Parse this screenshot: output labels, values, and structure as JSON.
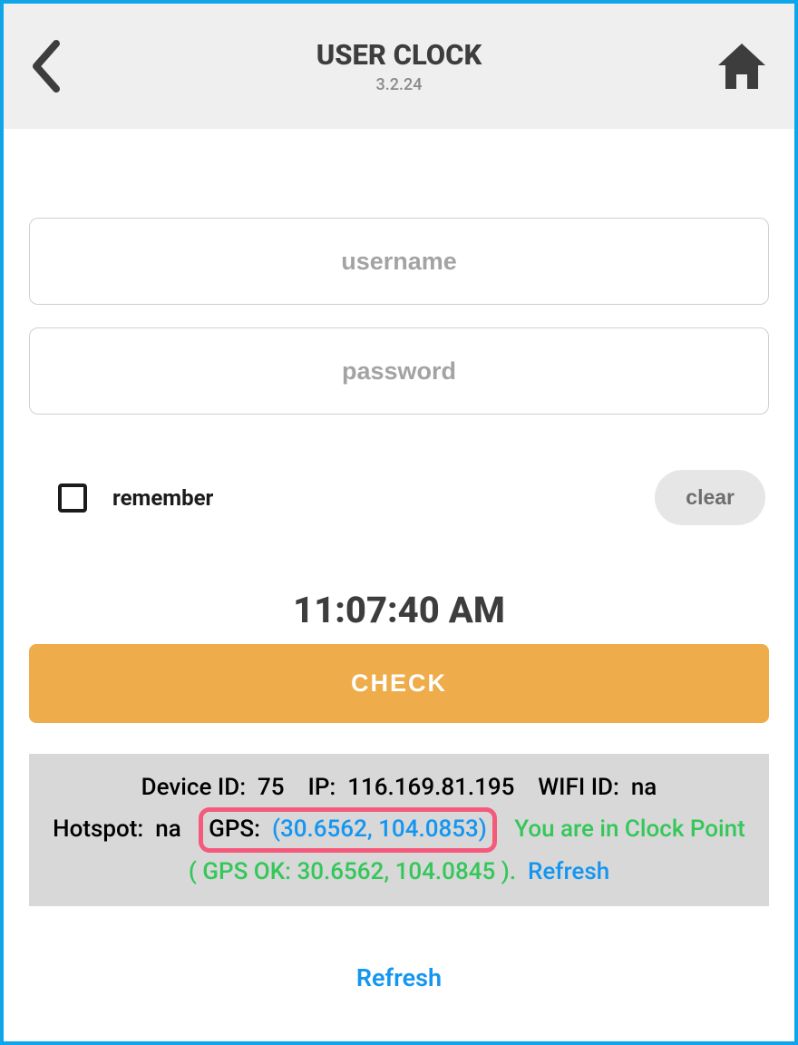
{
  "header": {
    "title": "USER CLOCK",
    "version": "3.2.24"
  },
  "form": {
    "username_placeholder": "username",
    "password_placeholder": "password",
    "remember_label": "remember",
    "clear_label": "clear"
  },
  "time": "11:07:40 AM",
  "check_label": "CHECK",
  "status": {
    "device_id_label": "Device ID:",
    "device_id": "75",
    "ip_label": "IP:",
    "ip": "116.169.81.195",
    "wifi_label": "WIFI ID:",
    "wifi": "na",
    "hotspot_label": "Hotspot:",
    "hotspot": "na",
    "gps_label": "GPS:",
    "gps_coords": "(30.6562, 104.0853)",
    "msg_prefix": "You are in Clock Point ( GPS OK: 30.6562, 104.0845 ).",
    "refresh": "Refresh"
  },
  "bottom_refresh": "Refresh"
}
